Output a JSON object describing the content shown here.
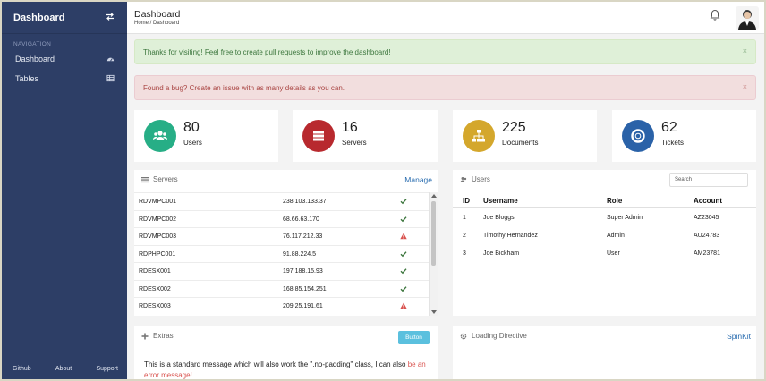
{
  "sidebar": {
    "brand": "Dashboard",
    "nav_header": "Navigation",
    "items": [
      {
        "label": "Dashboard",
        "icon": "dashboard-icon"
      },
      {
        "label": "Tables",
        "icon": "table-icon"
      }
    ],
    "footer": [
      "Github",
      "About",
      "Support"
    ]
  },
  "header": {
    "title": "Dashboard",
    "breadcrumb": "Home / Dashboard"
  },
  "alerts": [
    {
      "type": "success",
      "text": "Thanks for visiting! Feel free to create pull requests to improve the dashboard!",
      "close": "×"
    },
    {
      "type": "danger",
      "text": "Found a bug? Create an issue with as many details as you can.",
      "close": "×"
    }
  ],
  "stats": [
    {
      "value": "80",
      "label": "Users",
      "color": "#27ae86",
      "icon": "users-icon"
    },
    {
      "value": "16",
      "label": "Servers",
      "color": "#b8292e",
      "icon": "servers-icon"
    },
    {
      "value": "225",
      "label": "Documents",
      "color": "#d4a72c",
      "icon": "sitemap-icon"
    },
    {
      "value": "62",
      "label": "Tickets",
      "color": "#2a62a8",
      "icon": "life-ring-icon"
    }
  ],
  "servers": {
    "title": "Servers",
    "link": "Manage",
    "rows": [
      {
        "name": "RDVMPC001",
        "ip": "238.103.133.37",
        "status": "ok"
      },
      {
        "name": "RDVMPC002",
        "ip": "68.66.63.170",
        "status": "ok"
      },
      {
        "name": "RDVMPC003",
        "ip": "76.117.212.33",
        "status": "warning"
      },
      {
        "name": "RDPHPC001",
        "ip": "91.88.224.5",
        "status": "ok"
      },
      {
        "name": "RDESX001",
        "ip": "197.188.15.93",
        "status": "ok"
      },
      {
        "name": "RDESX002",
        "ip": "168.85.154.251",
        "status": "ok"
      },
      {
        "name": "RDESX003",
        "ip": "209.25.191.61",
        "status": "warning"
      }
    ]
  },
  "users": {
    "title": "Users",
    "search_placeholder": "Search",
    "columns": [
      "ID",
      "Username",
      "Role",
      "Account"
    ],
    "rows": [
      {
        "id": "1",
        "username": "Joe Bloggs",
        "role": "Super Admin",
        "account": "AZ23045"
      },
      {
        "id": "2",
        "username": "Timothy Hernandez",
        "role": "Admin",
        "account": "AU24783"
      },
      {
        "id": "3",
        "username": "Joe Bickham",
        "role": "User",
        "account": "AM23781"
      }
    ]
  },
  "extras": {
    "title": "Extras",
    "button": "Button",
    "text": "This is a standard message which will also work the \".no-padding\" class, I can also",
    "error_link": "be an error message!"
  },
  "loading": {
    "title": "Loading Directive",
    "link": "SpinKit"
  },
  "colors": {
    "sidebar": "#2d3e66",
    "ok": "#3c763d",
    "warning": "#d9534f",
    "link": "#2a6db0"
  }
}
